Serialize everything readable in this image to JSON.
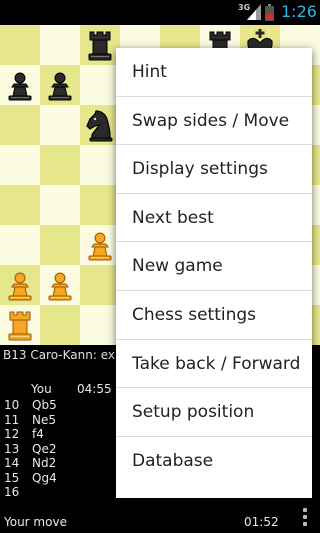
{
  "status_bar": {
    "network": "3G",
    "time": "1:26",
    "icons": [
      "signal-icon",
      "battery-icon"
    ]
  },
  "board": {
    "light_color": "#fbfbe0",
    "dark_color": "#e6e68c",
    "pieces_visible": [
      {
        "square": "c8",
        "piece": "black-rook"
      },
      {
        "square": "f8",
        "piece": "black-rook"
      },
      {
        "square": "g8",
        "piece": "black-king"
      },
      {
        "square": "a7",
        "piece": "black-pawn"
      },
      {
        "square": "b7",
        "piece": "black-pawn"
      },
      {
        "square": "c6",
        "piece": "black-knight"
      },
      {
        "square": "c3",
        "piece": "white-pawn"
      },
      {
        "square": "a2",
        "piece": "white-pawn"
      },
      {
        "square": "b2",
        "piece": "white-pawn"
      },
      {
        "square": "a1",
        "piece": "white-rook"
      }
    ]
  },
  "info": {
    "opening": "B13 Caro-Kann: ex",
    "player_label": "You",
    "player_clock": "04:55",
    "moves": [
      {
        "num": "10",
        "move": "Qb5"
      },
      {
        "num": "11",
        "move": "Ne5"
      },
      {
        "num": "12",
        "move": "f4"
      },
      {
        "num": "13",
        "move": "Qe2"
      },
      {
        "num": "14",
        "move": "Nd2"
      },
      {
        "num": "15",
        "move": "Qg4"
      },
      {
        "num": "16",
        "move": ""
      }
    ],
    "status_text": "Your move",
    "status_clock": "01:52"
  },
  "menu": {
    "items": [
      "Hint",
      "Swap sides / Move",
      "Display settings",
      "Next best",
      "New game",
      "Chess settings",
      "Take back / Forward",
      "Setup position",
      "Database"
    ]
  }
}
